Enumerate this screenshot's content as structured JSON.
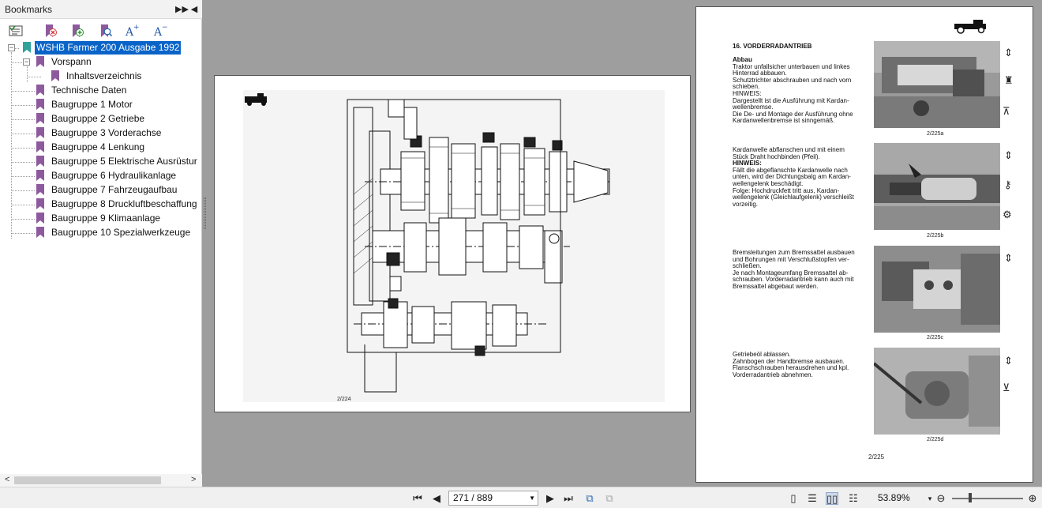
{
  "sidebar": {
    "title": "Bookmarks",
    "tree": [
      {
        "label": "WSHB Farmer 200 Ausgabe 1992",
        "level": 0,
        "selected": true
      },
      {
        "label": "Vorspann",
        "level": 1
      },
      {
        "label": "Inhaltsverzeichnis",
        "level": 2
      },
      {
        "label": "Technische Daten",
        "level": 1
      },
      {
        "label": "Baugruppe 1 Motor",
        "level": 1
      },
      {
        "label": "Baugruppe 2 Getriebe",
        "level": 1
      },
      {
        "label": "Baugruppe 3 Vorderachse",
        "level": 1
      },
      {
        "label": "Baugruppe 4 Lenkung",
        "level": 1
      },
      {
        "label": "Baugruppe 5 Elektrische Ausrüstur",
        "level": 1
      },
      {
        "label": "Baugruppe 6 Hydraulikanlage",
        "level": 1
      },
      {
        "label": "Baugruppe 7 Fahrzeugaufbau",
        "level": 1
      },
      {
        "label": "Baugruppe 8 Druckluftbeschaffung",
        "level": 1
      },
      {
        "label": "Baugruppe 9 Klimaanlage",
        "level": 1
      },
      {
        "label": "Baugruppe 10 Spezialwerkzeuge",
        "level": 1
      }
    ]
  },
  "left_page": {
    "caption": "2/224"
  },
  "right_page": {
    "heading": "16. VORDERRADANTRIEB",
    "sections": [
      {
        "lines": [
          {
            "t": "Abbau",
            "b": true
          },
          {
            "t": "Traktor unfallsicher unterbauen und linkes"
          },
          {
            "t": "Hinterrad abbauen."
          },
          {
            "t": "Schutztrichter abschrauben und nach vorn"
          },
          {
            "t": "schieben."
          },
          {
            "t": "HINWEIS:"
          },
          {
            "t": "Dargestellt ist die Ausführung mit Kardan-"
          },
          {
            "t": "wellenbremse."
          },
          {
            "t": "Die De- und Montage der Ausführung ohne"
          },
          {
            "t": "Kardanwellenbremse ist sinngemäß."
          }
        ],
        "caption": "2/225a"
      },
      {
        "lines": [
          {
            "t": "Kardanwelle abflanschen und mit einem"
          },
          {
            "t": "Stück Draht hochbinden (Pfeil)."
          },
          {
            "t": "HINWEIS:",
            "b": true
          },
          {
            "t": "Fällt die abgeflanschte Kardanwelle nach"
          },
          {
            "t": "unten, wird der Dichtungsbalg am Kardan-"
          },
          {
            "t": "wellengelenk beschädigt."
          },
          {
            "t": "Folge: Hochdruckfett tritt aus, Kardan-"
          },
          {
            "t": "wellengelenk (Gleichlaufgelenk) verschleißt"
          },
          {
            "t": "vorzeitig."
          }
        ],
        "caption": "2/225b"
      },
      {
        "lines": [
          {
            "t": "Bremsleitungen zum Bremssattel ausbauen"
          },
          {
            "t": "und Bohrungen mit Verschlußstopfen ver-"
          },
          {
            "t": "schließen."
          },
          {
            "t": "Je nach Montageumfang Bremssattel ab-"
          },
          {
            "t": "schrauben. Vorderradantrieb kann auch mit"
          },
          {
            "t": "Bremssattel abgebaut werden."
          }
        ],
        "caption": "2/225c"
      },
      {
        "lines": [
          {
            "t": "Getriebeöl ablassen."
          },
          {
            "t": "Zahnbogen der Handbremse ausbauen."
          },
          {
            "t": "Flanschschrauben herausdrehen und kpl."
          },
          {
            "t": "Vorderradantrieb abnehmen."
          }
        ],
        "caption": "2/225d"
      }
    ],
    "footer": "2/225"
  },
  "bottombar": {
    "page_value": "271 / 889",
    "zoom": "53.89%"
  }
}
